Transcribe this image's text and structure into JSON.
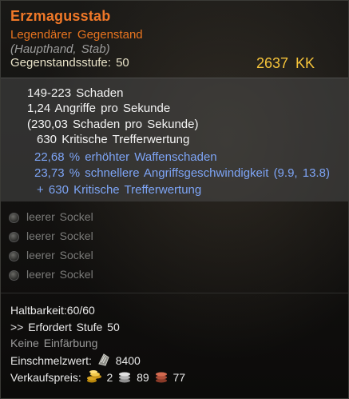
{
  "item": {
    "name": "Erzmagusstab",
    "rarity": "Legendärer Gegenstand",
    "slot": "(Haupthand, Stab)",
    "item_level": "Gegenstandsstufe: 50",
    "price": "2637 KK"
  },
  "stats": {
    "damage": "149-223 Schaden",
    "speed": "1,24 Angriffe pro Sekunde",
    "dps": "(230,03 Schaden pro Sekunde)",
    "crit": "630 Kritische Trefferwertung",
    "bonus_damage": "22,68 % erhöhter Waffenschaden",
    "bonus_speed": "23,73 % schnellere Angriffsgeschwindigkeit (9.9, 13.8)",
    "bonus_crit": "+ 630 Kritische Trefferwertung"
  },
  "sockets": [
    {
      "label": "leerer Sockel"
    },
    {
      "label": "leerer Sockel"
    },
    {
      "label": "leerer Sockel"
    },
    {
      "label": "leerer Sockel"
    }
  ],
  "footer": {
    "durability": "Haltbarkeit:60/60",
    "requirement": ">> Erfordert Stufe 50",
    "dye": "Keine Einfärbung",
    "smelt_label": "Einschmelzwert:",
    "smelt_value": "8400",
    "sell_label": "Verkaufspreis:",
    "sell_gold": "2",
    "sell_silver": "89",
    "sell_copper": "77"
  },
  "colors": {
    "title": "#f07828",
    "rarity": "#e8741f",
    "price": "#f5c33a",
    "bonus": "#7da4f5"
  },
  "icons": [
    "smelt-icon",
    "gold-coin-icon",
    "silver-coin-icon",
    "copper-coin-icon"
  ]
}
